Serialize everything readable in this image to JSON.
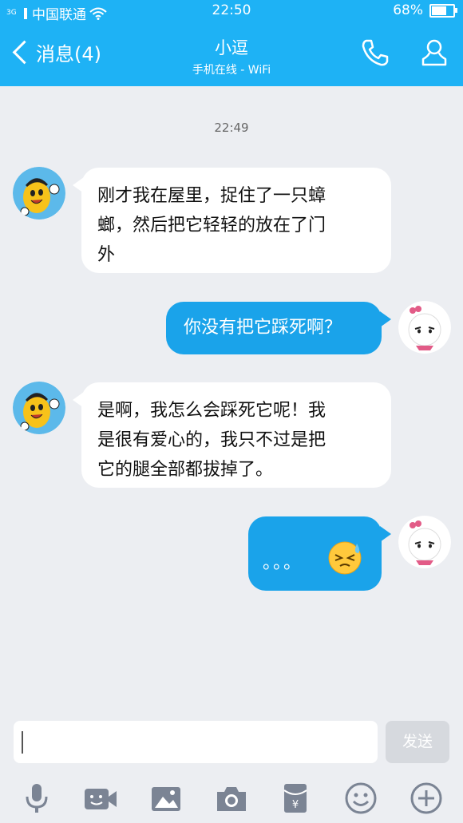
{
  "status": {
    "carrier": "中国联通",
    "network": "3G",
    "time": "22:50",
    "battery": "68%",
    "battery_level": 0.68
  },
  "nav": {
    "back_label": "消息(4)",
    "contact_name": "小逗",
    "contact_status": "手机在线 - WiFi"
  },
  "chat": {
    "timestamp": "22:49",
    "messages": [
      {
        "from": "them",
        "lines": [
          "刚才我在屋里，捉住了一只蟑",
          "螂，然后把它轻轻的放在了门",
          "外"
        ]
      },
      {
        "from": "me",
        "lines": [
          "你没有把它踩死啊？"
        ]
      },
      {
        "from": "them",
        "lines": [
          "是啊，我怎么会踩死它呢！我",
          "是很有爱心的，我只不过是把",
          "它的腿全部都拔掉了。"
        ]
      },
      {
        "from": "me",
        "lines": [
          "。。。"
        ],
        "emoji": "sweat-face"
      }
    ]
  },
  "input": {
    "send_label": "发送"
  },
  "toolbar": {
    "items": [
      "microphone-icon",
      "video-icon",
      "image-icon",
      "camera-icon",
      "red-packet-icon",
      "emoji-icon",
      "plus-icon"
    ]
  },
  "colors": {
    "accent": "#1eb2f5",
    "bubble_out": "#1aa3ea",
    "background": "#eceef2"
  }
}
